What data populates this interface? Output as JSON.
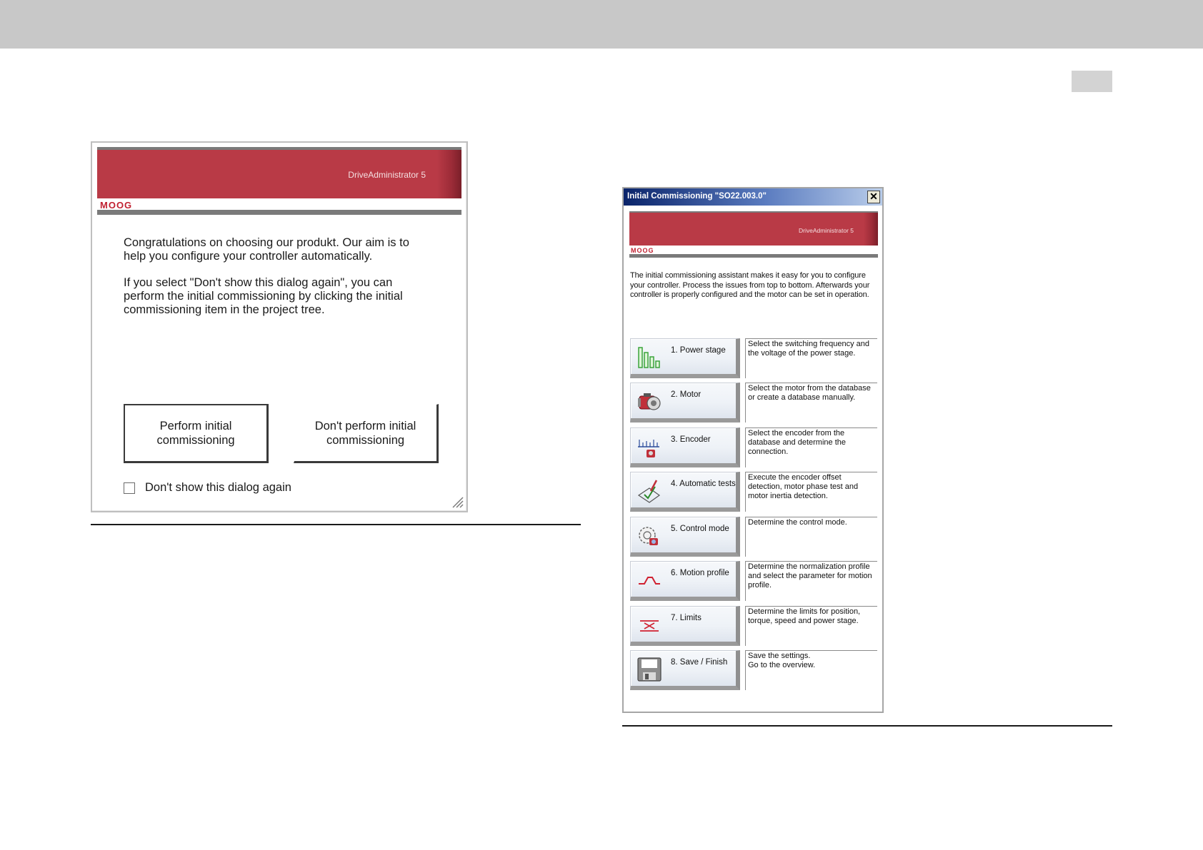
{
  "dialog_welcome": {
    "app_name": "DriveAdministrator 5",
    "brand": "MOOG",
    "paragraph_1": "Congratulations on choosing our produkt. Our aim is to help you configure your controller automatically.",
    "paragraph_2": "If you select \"Don't show this dialog again\", you can perform the initial commissioning by clicking the initial commissioning item in the project tree.",
    "perform_button": "Perform initial commissioning",
    "dont_perform_button": "Don't perform initial commissioning",
    "checkbox_label": "Don't show this dialog again",
    "checkbox_checked": false
  },
  "dialog_commissioning": {
    "title": "Initial Commissioning \"SO22.003.0\"",
    "close_symbol": "✕",
    "app_name": "DriveAdministrator 5",
    "brand": "MOOG",
    "intro": "The initial commissioning assistant makes it easy for you to configure your controller. Process the issues from top to bottom. Afterwards your controller is properly configured and the motor can be set in operation.",
    "steps": [
      {
        "label": "1. Power stage",
        "icon": "power-stage-bars-icon",
        "description": "Select the switching frequency and the voltage of the power stage."
      },
      {
        "label": "2. Motor",
        "icon": "motor-icon",
        "description": "Select the motor from the database or create a database manually."
      },
      {
        "label": "3. Encoder",
        "icon": "encoder-icon",
        "description": "Select the encoder from the database and determine the connection."
      },
      {
        "label": "4. Automatic tests",
        "icon": "automatic-tests-icon",
        "description": "Execute the encoder offset detection, motor phase test and motor inertia detection."
      },
      {
        "label": "5. Control mode",
        "icon": "control-mode-icon",
        "description": "Determine the control mode."
      },
      {
        "label": "6. Motion profile",
        "icon": "motion-profile-icon",
        "description": "Determine the normalization profile and select the parameter for motion profile."
      },
      {
        "label": "7. Limits",
        "icon": "limits-icon",
        "description": "Determine the limits for position, torque, speed and power stage."
      },
      {
        "label": "8. Save / Finish",
        "icon": "save-floppy-icon",
        "description": "Save the settings.\nGo to the overview."
      }
    ]
  },
  "colors": {
    "banner_red": "#b93a46",
    "header_band": "#c8c8c8",
    "titlebar_blue": "#0a246a"
  }
}
